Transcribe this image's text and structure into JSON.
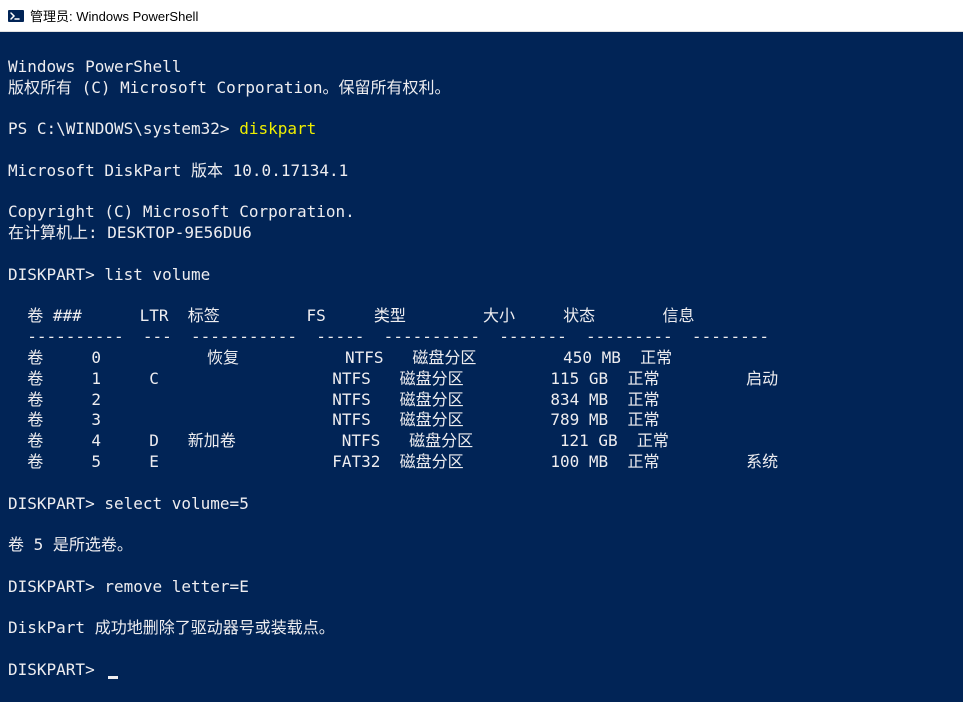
{
  "titlebar": {
    "title": "管理员: Windows PowerShell"
  },
  "terminal": {
    "banner1": "Windows PowerShell",
    "banner2": "版权所有 (C) Microsoft Corporation。保留所有权利。",
    "blank": "",
    "prompt_ps": "PS C:\\WINDOWS\\system32> ",
    "cmd_diskpart": "diskpart",
    "dp_banner": "Microsoft DiskPart 版本 10.0.17134.1",
    "dp_copyright": "Copyright (C) Microsoft Corporation.",
    "dp_computer": "在计算机上: DESKTOP-9E56DU6",
    "dp_prompt1": "DISKPART> ",
    "cmd_listvol": "list volume",
    "vol_header": "  卷 ###      LTR  标签         FS     类型        大小     状态       信息",
    "vol_divider": "  ----------  ---  -----------  -----  ----------  -------  ---------  --------",
    "vol_rows": [
      "  卷     0           恢复           NTFS   磁盘分区         450 MB  正常",
      "  卷     1     C                  NTFS   磁盘分区         115 GB  正常         启动",
      "  卷     2                        NTFS   磁盘分区         834 MB  正常",
      "  卷     3                        NTFS   磁盘分区         789 MB  正常",
      "  卷     4     D   新加卷           NTFS   磁盘分区         121 GB  正常",
      "  卷     5     E                  FAT32  磁盘分区         100 MB  正常         系统"
    ],
    "dp_prompt2": "DISKPART> ",
    "cmd_selectvol": "select volume=5",
    "msg_selected": "卷 5 是所选卷。",
    "dp_prompt3": "DISKPART> ",
    "cmd_removeletter": "remove letter=E",
    "msg_removed": "DiskPart 成功地删除了驱动器号或装载点。",
    "dp_prompt4": "DISKPART> "
  }
}
